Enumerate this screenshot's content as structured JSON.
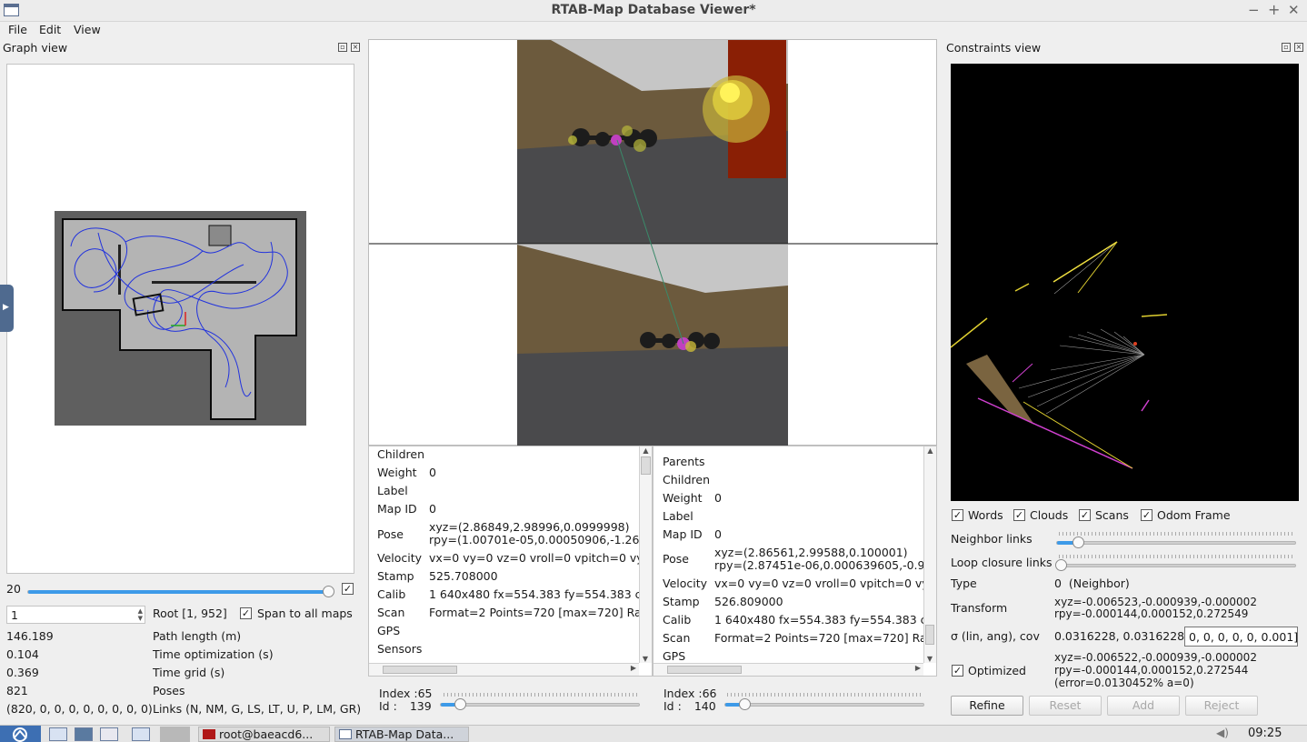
{
  "window": {
    "title": "RTAB-Map Database Viewer*"
  },
  "menu": {
    "file": "File",
    "edit": "Edit",
    "view": "View"
  },
  "graph_view": {
    "title": "Graph view",
    "slider_value": "20",
    "root_spin_value": "1",
    "root_label": "Root [1, 952]",
    "span_label": "Span to all maps",
    "stats": [
      {
        "value": "146.189",
        "label": "Path length (m)"
      },
      {
        "value": "0.104",
        "label": "Time optimization (s)"
      },
      {
        "value": "0.369",
        "label": "Time grid (s)"
      },
      {
        "value": "821",
        "label": "Poses"
      },
      {
        "value": "(820, 0, 0, 0, 0, 0, 0, 0, 0)",
        "label": "Links (N, NM, G, LS, LT, U, P, LM, GR)"
      }
    ]
  },
  "left_node_info": {
    "rows": [
      {
        "label": "Children",
        "value": ""
      },
      {
        "label": "Weight",
        "value": "0"
      },
      {
        "label": "Label",
        "value": ""
      },
      {
        "label": "Map ID",
        "value": "0"
      },
      {
        "label": "Pose",
        "value": "xyz=(2.86849,2.98996,0.0999998)",
        "value2": "rpy=(1.00701e-05,0.00050906,-1.262"
      },
      {
        "label": "Velocity",
        "value": "vx=0 vy=0 vz=0 vroll=0 vpitch=0 vya"
      },
      {
        "label": "Stamp",
        "value": "525.708000"
      },
      {
        "label": "Calib",
        "value": "1 640x480 fx=554.383 fy=554.383 cx"
      },
      {
        "label": "Scan",
        "value": "Format=2 Points=720 [max=720] Ran"
      },
      {
        "label": "GPS",
        "value": ""
      },
      {
        "label": "Sensors",
        "value": ""
      }
    ],
    "index_label": "Index :",
    "index_value": "65",
    "id_label": "Id :",
    "id_value": "139"
  },
  "right_node_info": {
    "rows": [
      {
        "label": "Parents",
        "value": ""
      },
      {
        "label": "Children",
        "value": ""
      },
      {
        "label": "Weight",
        "value": "0"
      },
      {
        "label": "Label",
        "value": ""
      },
      {
        "label": "Map ID",
        "value": "0"
      },
      {
        "label": "Pose",
        "value": "xyz=(2.86561,2.99588,0.100001)",
        "value2": "rpy=(2.87451e-06,0.000639605,-0.98"
      },
      {
        "label": "Velocity",
        "value": "vx=0 vy=0 vz=0 vroll=0 vpitch=0 vya"
      },
      {
        "label": "Stamp",
        "value": "526.809000"
      },
      {
        "label": "Calib",
        "value": "1 640x480 fx=554.383 fy=554.383 cx"
      },
      {
        "label": "Scan",
        "value": "Format=2 Points=720 [max=720] Ran"
      },
      {
        "label": "GPS",
        "value": ""
      }
    ],
    "index_label": "Index :",
    "index_value": "66",
    "id_label": "Id :",
    "id_value": "140"
  },
  "constraints_view": {
    "title": "Constraints view",
    "checks": {
      "words": "Words",
      "clouds": "Clouds",
      "scans": "Scans",
      "odom_frame": "Odom Frame"
    },
    "neighbor_links_label": "Neighbor links",
    "loop_closure_links_label": "Loop closure links",
    "type_label": "Type",
    "type_value": "0  (Neighbor)",
    "transform_label": "Transform",
    "transform_line1": "xyz=-0.006523,-0.000939,-0.000002",
    "transform_line2": "rpy=-0.000144,0.000152,0.272549",
    "sigma_label": "σ (lin, ang), cov",
    "sigma_value": "0.0316228, 0.0316228",
    "cov_value": "0, 0, 0, 0, 0, 0.001]",
    "optimized_label": "Optimized",
    "optimized_line1": "xyz=-0.006522,-0.000939,-0.000002",
    "optimized_line2": "rpy=-0.000144,0.000152,0.272544",
    "optimized_line3": "(error=0.0130452% a=0)",
    "buttons": {
      "refine": "Refine",
      "reset": "Reset",
      "add": "Add",
      "reject": "Reject"
    }
  },
  "taskbar": {
    "terminal_label": "root@baeacd6...",
    "app_label": "RTAB-Map Data...",
    "clock": "09:25"
  }
}
